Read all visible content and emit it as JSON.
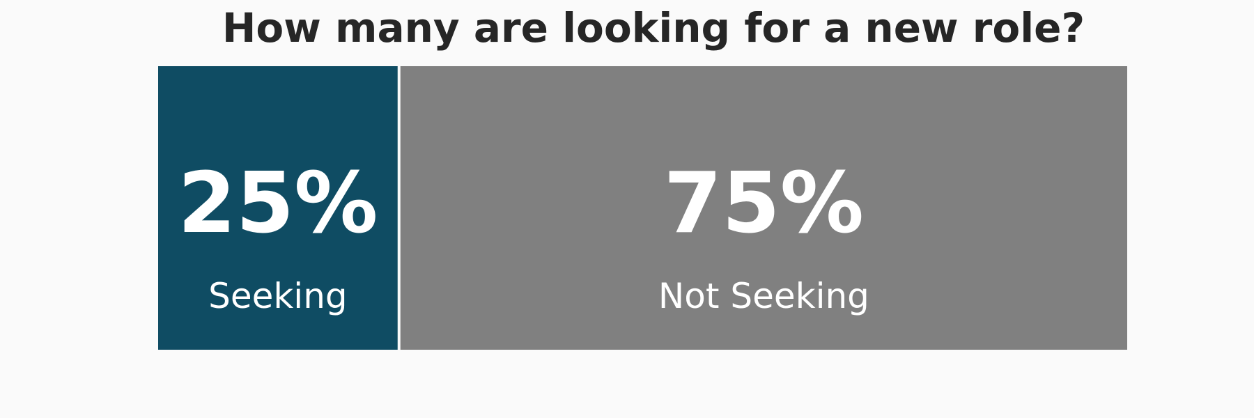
{
  "chart_data": {
    "type": "bar",
    "orientation": "horizontal-stacked",
    "title": "How many are looking for a new role?",
    "categories": [
      "Seeking",
      "Not Seeking"
    ],
    "values": [
      25,
      75
    ],
    "value_labels": [
      "25%",
      "75%"
    ],
    "unit": "%",
    "colors": [
      "#0f4c63",
      "#808080"
    ],
    "legend": "none",
    "grid": false
  }
}
